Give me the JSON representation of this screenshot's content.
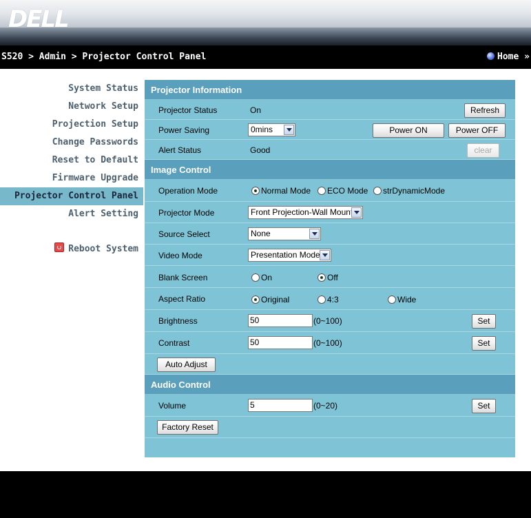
{
  "brand": "DELL",
  "breadcrumb": "S520 > Admin > Projector Control Panel",
  "home_label": "Home »",
  "sidebar": {
    "items": [
      {
        "label": "System Status"
      },
      {
        "label": "Network Setup"
      },
      {
        "label": "Projection Setup"
      },
      {
        "label": "Change Passwords"
      },
      {
        "label": "Reset to Default"
      },
      {
        "label": "Firmware Upgrade"
      },
      {
        "label": "Projector Control Panel"
      },
      {
        "label": "Alert Setting"
      }
    ],
    "active_index": 6,
    "reboot_label": "Reboot System"
  },
  "projector_info": {
    "title": "Projector Information",
    "status_label": "Projector Status",
    "status_value": "On",
    "refresh_button": "Refresh",
    "power_saving_label": "Power Saving",
    "power_saving_value": "0mins",
    "power_on_button": "Power ON",
    "power_off_button": "Power OFF",
    "alert_label": "Alert Status",
    "alert_value": "Good",
    "clear_button": "clear"
  },
  "image_control": {
    "title": "Image Control",
    "operation_mode_label": "Operation Mode",
    "operation_modes": [
      "Normal Mode",
      "ECO Mode",
      "strDynamicMode"
    ],
    "operation_mode_selected": 0,
    "projector_mode_label": "Projector Mode",
    "projector_mode_value": "Front Projection-Wall Mount",
    "source_select_label": "Source Select",
    "source_select_value": "None",
    "video_mode_label": "Video Mode",
    "video_mode_value": "Presentation Mode",
    "blank_screen_label": "Blank Screen",
    "blank_options": [
      "On",
      "Off"
    ],
    "blank_selected": 1,
    "aspect_label": "Aspect Ratio",
    "aspect_options": [
      "Original",
      "4:3",
      "Wide"
    ],
    "aspect_selected": 0,
    "brightness_label": "Brightness",
    "brightness_value": "50",
    "brightness_range": "(0~100)",
    "contrast_label": "Contrast",
    "contrast_value": "50",
    "contrast_range": "(0~100)",
    "set_button": "Set",
    "auto_adjust_button": "Auto Adjust"
  },
  "audio_control": {
    "title": "Audio Control",
    "volume_label": "Volume",
    "volume_value": "5",
    "volume_range": "(0~20)",
    "set_button": "Set",
    "factory_reset_button": "Factory Reset"
  },
  "colors": {
    "panel": "#7fc4d6",
    "section_header": "#5a9fbb",
    "sidebar_active": "#77b8cb",
    "sidebar_text": "#4c5f6e"
  }
}
